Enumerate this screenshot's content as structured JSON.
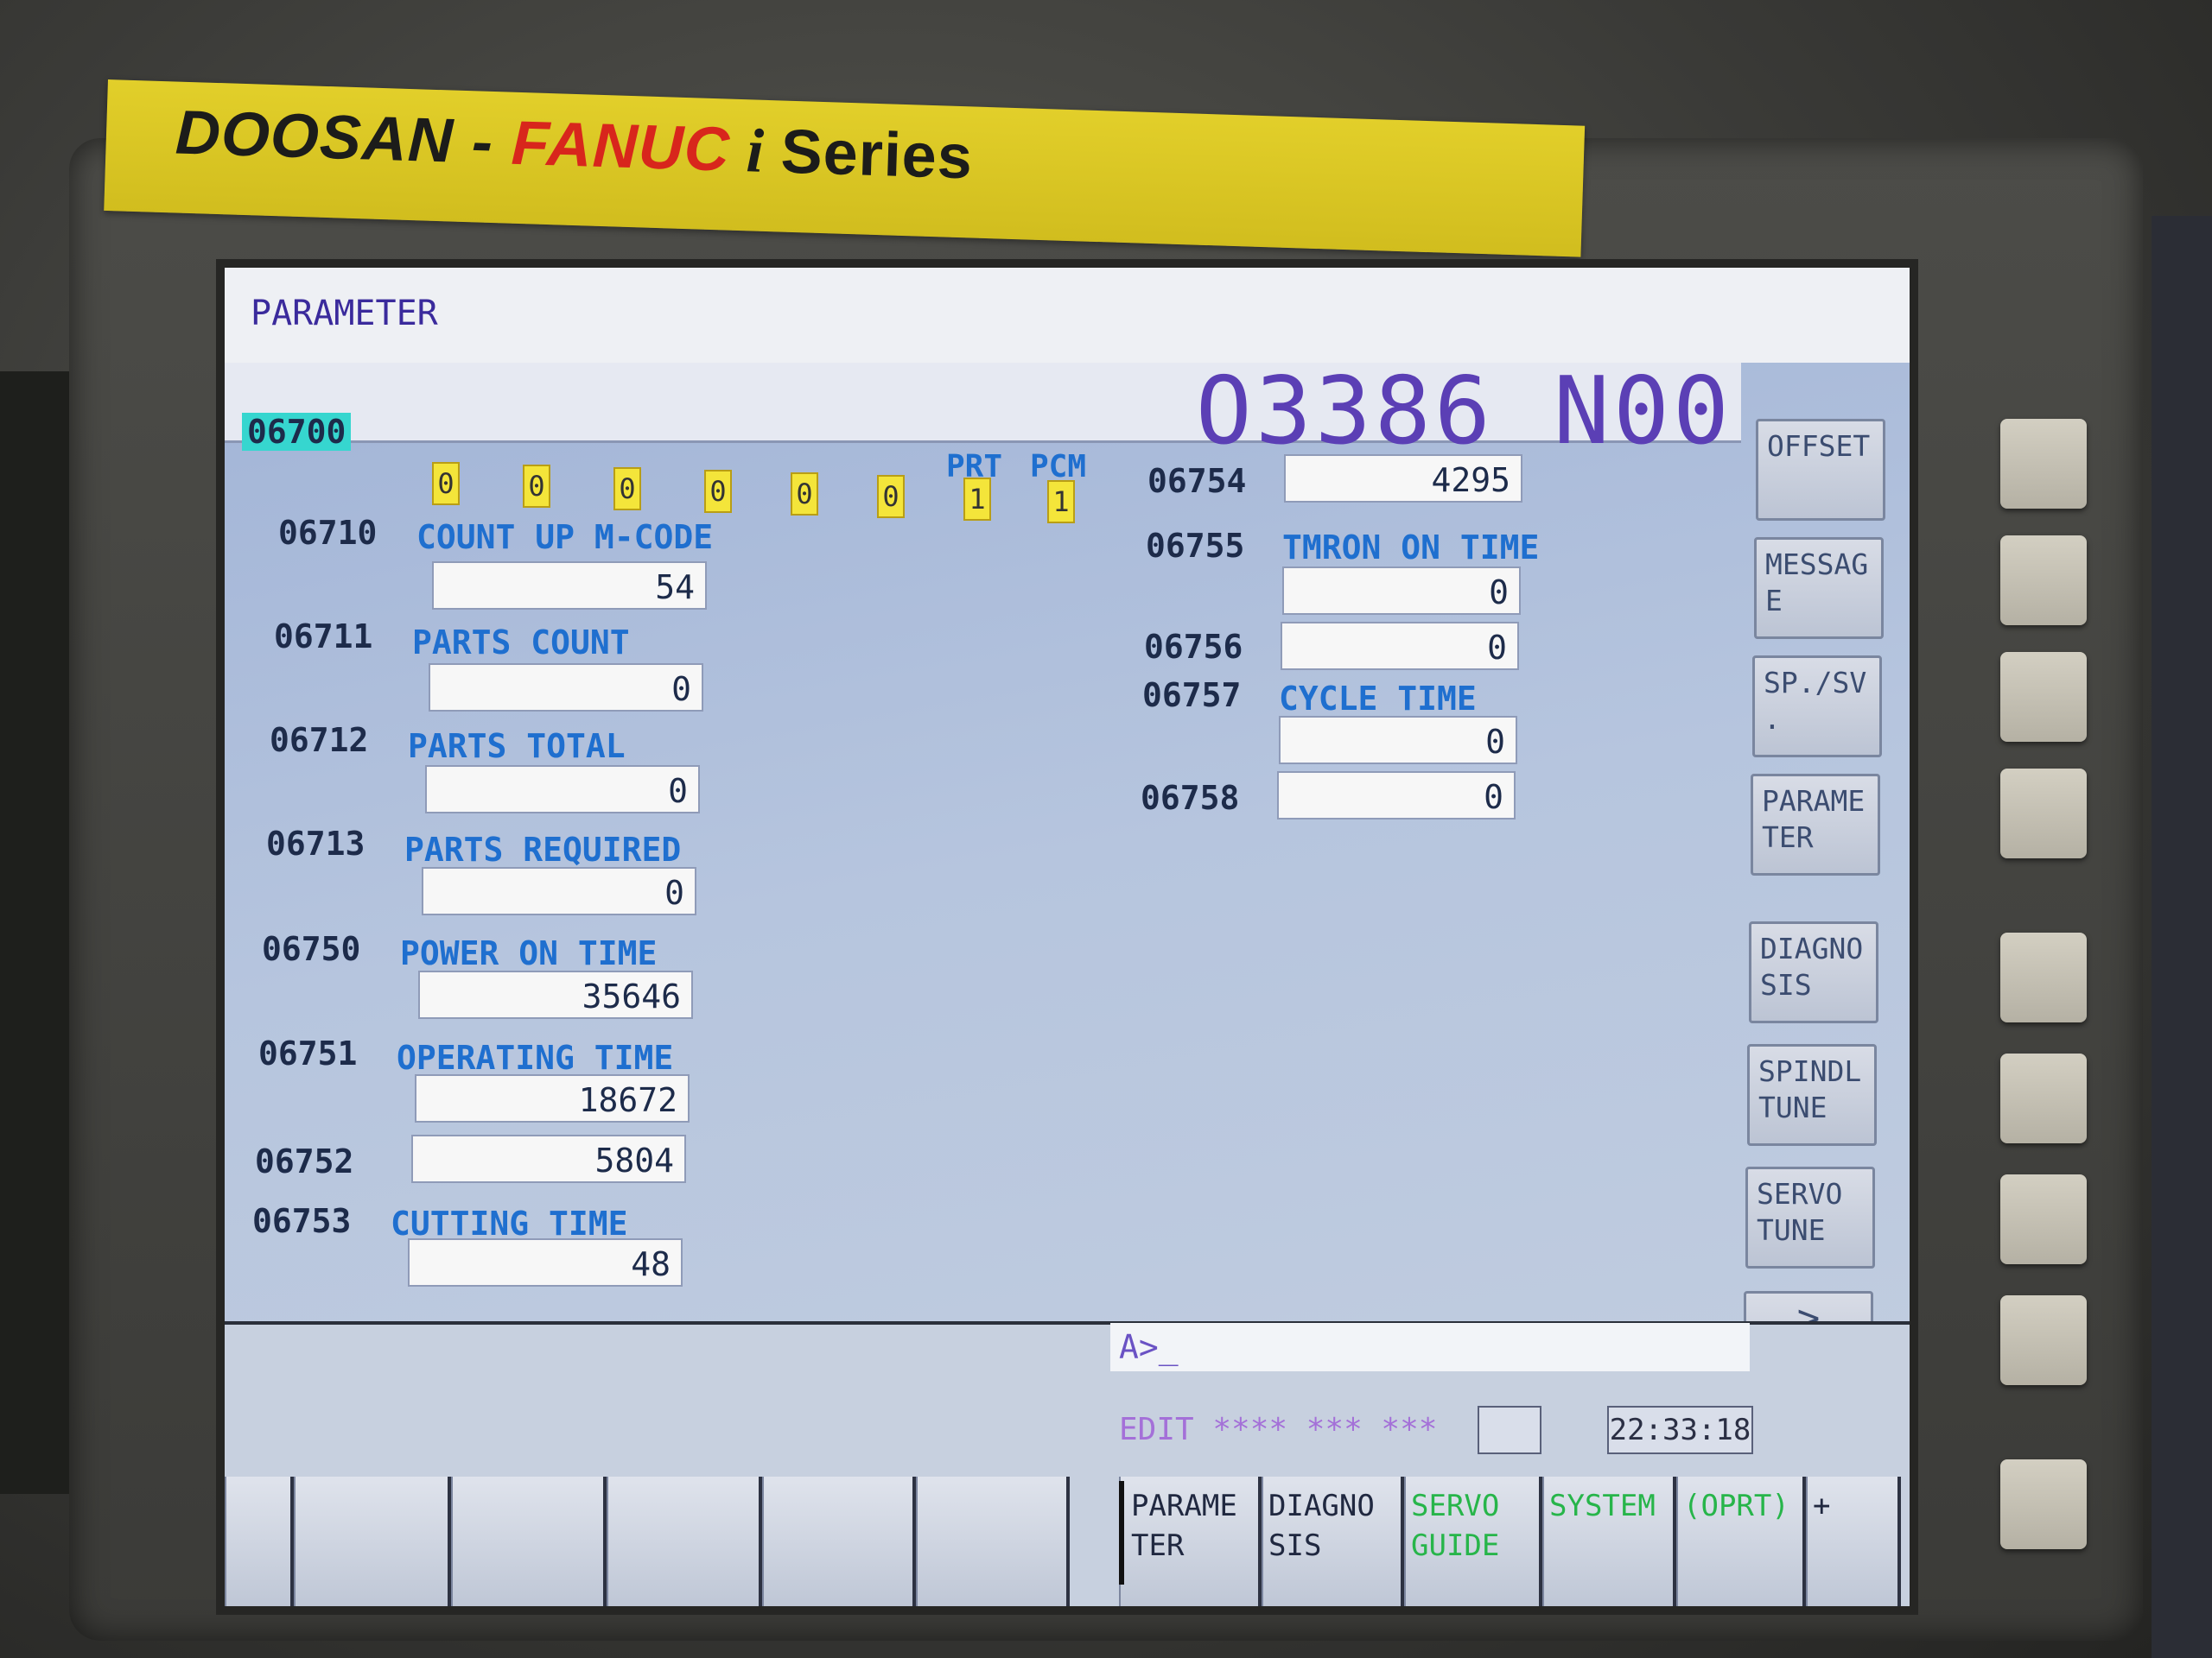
{
  "brand": {
    "part1": "DOOSAN",
    "sep": " - ",
    "part2": "FANUC",
    "part3": " i ",
    "part4": "Series"
  },
  "screen": {
    "title": "PARAMETER",
    "program": "O3386 N00",
    "selected_param": "06700",
    "bit_labels": [
      "PRT",
      "PCM"
    ],
    "bits": [
      "0",
      "0",
      "0",
      "0",
      "0",
      "0",
      "1",
      "1"
    ],
    "left_params": [
      {
        "no": "06710",
        "name": "COUNT UP M-CODE",
        "value": "54"
      },
      {
        "no": "06711",
        "name": "PARTS COUNT",
        "value": "0"
      },
      {
        "no": "06712",
        "name": "PARTS TOTAL",
        "value": "0"
      },
      {
        "no": "06713",
        "name": "PARTS REQUIRED",
        "value": "0"
      },
      {
        "no": "06750",
        "name": "POWER ON TIME",
        "value": "35646"
      },
      {
        "no": "06751",
        "name": "OPERATING TIME",
        "value": "18672"
      },
      {
        "no": "06752",
        "name": "",
        "value": "5804"
      },
      {
        "no": "06753",
        "name": "CUTTING TIME",
        "value": "48"
      }
    ],
    "right_params": [
      {
        "no": "06754",
        "name": "",
        "value": "4295"
      },
      {
        "no": "06755",
        "name": "TMRON ON TIME",
        "value": "0"
      },
      {
        "no": "06756",
        "name": "",
        "value": "0"
      },
      {
        "no": "06757",
        "name": "CYCLE TIME",
        "value": "0"
      },
      {
        "no": "06758",
        "name": "",
        "value": "0"
      }
    ],
    "command_prompt": "A>_",
    "status": "EDIT **** *** ***",
    "clock": "22:33:18"
  },
  "vertical_softkeys": [
    "OFFSET",
    "MESSAG\nE",
    "SP./SV\n.",
    "PARAME\nTER",
    "DIAGNO\nSIS",
    "SPINDL\nTUNE",
    "SERVO\nTUNE",
    ">"
  ],
  "horizontal_softkeys": [
    {
      "label": "PARAME\nTER",
      "color": "#202840"
    },
    {
      "label": "DIAGNO\nSIS",
      "color": "#202840"
    },
    {
      "label": "SERVO\nGUIDE",
      "color": "#27b54a"
    },
    {
      "label": "SYSTEM",
      "color": "#27b54a"
    },
    {
      "label": "(OPRT)",
      "color": "#27b54a"
    },
    {
      "label": "+",
      "color": "#202840"
    }
  ],
  "colors": {
    "param_name": "#1f6fcf",
    "selection": "#36d6cf",
    "bit_on": "#f4e53a",
    "program_number": "#5b3fb5"
  }
}
